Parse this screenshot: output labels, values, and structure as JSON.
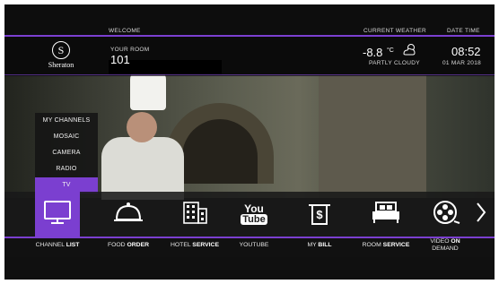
{
  "header": {
    "welcome_label": "WELCOME",
    "weather_label": "CURRENT WEATHER",
    "datetime_label": "DATE TIME"
  },
  "info": {
    "brand_letter": "S",
    "brand_name": "Sheraton",
    "room_label": "YOUR ROOM",
    "room_number": "101",
    "temperature": "-8.8",
    "temp_unit": "°C",
    "weather_condition": "PARTLY CLOUDY",
    "weather_icon": "partly-cloudy-icon",
    "time": "08:52",
    "date": "01 MAR 2018"
  },
  "menu": {
    "items": [
      "MY CHANNELS",
      "MOSAIC",
      "CAMERA",
      "RADIO",
      "TV"
    ],
    "selected": "TV"
  },
  "services": [
    {
      "prefix": "CHANNEL ",
      "bold": "LIST",
      "icon": "tv-icon",
      "active": true
    },
    {
      "prefix": "FOOD ",
      "bold": "ORDER",
      "icon": "cloche-icon"
    },
    {
      "prefix": "HOTEL ",
      "bold": "SERVICE",
      "icon": "hotel-icon"
    },
    {
      "prefix": "YOUTUBE",
      "bold": "",
      "icon": "youtube-icon",
      "icon_text_top": "You",
      "icon_text_bottom": "Tube"
    },
    {
      "prefix": "MY ",
      "bold": "BILL",
      "icon": "bill-icon",
      "icon_text": "$"
    },
    {
      "prefix": "ROOM ",
      "bold": "SERVICE",
      "icon": "bed-icon"
    },
    {
      "prefix": "VIDEO ",
      "bold": "ON",
      "line2": "DEMAND",
      "icon": "film-reel-icon"
    }
  ],
  "accent_color": "#7b3fd0"
}
